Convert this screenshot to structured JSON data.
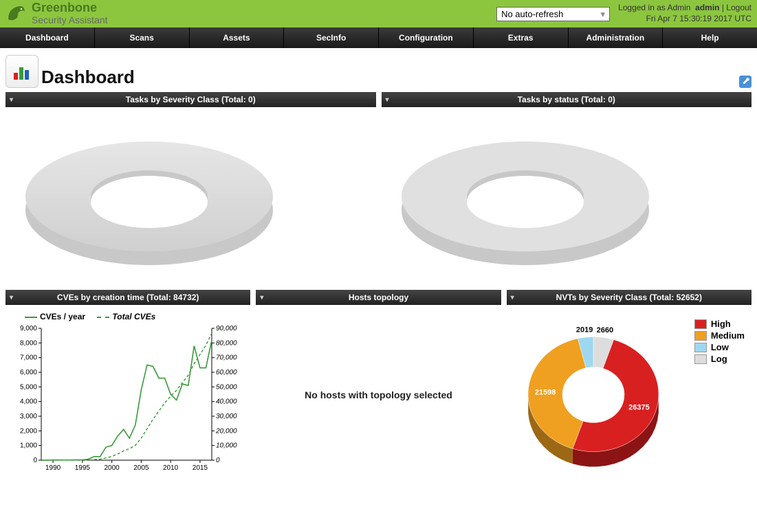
{
  "brand": {
    "line1": "Greenbone",
    "line2": "Security Assistant"
  },
  "refresh_selected": "No auto-refresh",
  "login": {
    "prefix": "Logged in as Admin",
    "username": "admin",
    "logout": "Logout",
    "timestamp": "Fri Apr 7 15:30:19 2017 UTC"
  },
  "menu": [
    "Dashboard",
    "Scans",
    "Assets",
    "SecInfo",
    "Configuration",
    "Extras",
    "Administration",
    "Help"
  ],
  "page_title": "Dashboard",
  "widgets": {
    "tasks_severity": "Tasks by Severity Class (Total: 0)",
    "tasks_status": "Tasks by status (Total: 0)",
    "cves_time": "CVEs by creation time (Total: 84732)",
    "hosts_topo": "Hosts topology",
    "nvts_severity": "NVTs by Severity Class (Total: 52652)"
  },
  "topo_message": "No hosts with topology selected",
  "chart_data": [
    {
      "type": "line",
      "title": "CVEs by creation time (Total: 84732)",
      "series_legend": {
        "s1": "CVEs / year",
        "s2": "Total CVEs"
      },
      "x": [
        1988,
        1989,
        1990,
        1991,
        1992,
        1993,
        1994,
        1995,
        1996,
        1997,
        1998,
        1999,
        2000,
        2001,
        2002,
        2003,
        2004,
        2005,
        2006,
        2007,
        2008,
        2009,
        2010,
        2011,
        2012,
        2013,
        2014,
        2015,
        2016,
        2017
      ],
      "cves_per_year": [
        1,
        2,
        10,
        14,
        12,
        12,
        24,
        24,
        72,
        250,
        240,
        890,
        1000,
        1650,
        2100,
        1500,
        2400,
        4800,
        6500,
        6400,
        5600,
        5600,
        4500,
        4100,
        5200,
        5100,
        7800,
        6300,
        6300,
        8200
      ],
      "total_cves": [
        1,
        3,
        13,
        27,
        39,
        51,
        75,
        99,
        171,
        421,
        661,
        1551,
        2551,
        4201,
        6301,
        7801,
        10201,
        15001,
        21501,
        27901,
        33501,
        39101,
        43601,
        47701,
        52901,
        58001,
        65801,
        72101,
        78401,
        86601
      ],
      "xlabel": "",
      "ylabel_left": "CVEs / year",
      "ylabel_right": "Total CVEs",
      "ylim_left": [
        0,
        9000
      ],
      "ylim_right": [
        0,
        90000
      ],
      "x_ticks": [
        1990,
        1995,
        2000,
        2005,
        2010,
        2015
      ],
      "y_left_ticks": [
        0,
        1000,
        2000,
        3000,
        4000,
        5000,
        6000,
        7000,
        8000,
        9000
      ],
      "y_right_ticks": [
        0,
        10000,
        20000,
        30000,
        40000,
        50000,
        60000,
        70000,
        80000,
        90000
      ]
    },
    {
      "type": "pie",
      "title": "NVTs by Severity Class (Total: 52652)",
      "slices": [
        {
          "name": "High",
          "value": 26375,
          "color": "#d92020"
        },
        {
          "name": "Medium",
          "value": 21598,
          "color": "#f0a020"
        },
        {
          "name": "Low",
          "value": 2019,
          "color": "#9ed8f0"
        },
        {
          "name": "Log",
          "value": 2660,
          "color": "#dddddd"
        }
      ]
    }
  ],
  "nvt_legend": [
    {
      "name": "High",
      "color": "#d92020"
    },
    {
      "name": "Medium",
      "color": "#f0a020"
    },
    {
      "name": "Low",
      "color": "#9ed8f0"
    },
    {
      "name": "Log",
      "color": "#dddddd"
    }
  ]
}
